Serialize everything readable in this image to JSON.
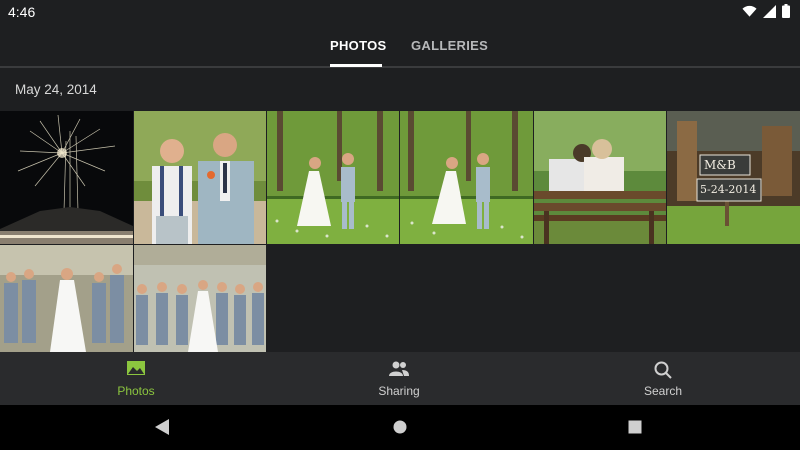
{
  "status": {
    "time": "4:46",
    "icons": [
      "wifi-icon",
      "signal-icon",
      "battery-icon"
    ]
  },
  "tabs": [
    {
      "label": "PHOTOS",
      "selected": true
    },
    {
      "label": "GALLERIES",
      "selected": false
    }
  ],
  "date_header": "May 24, 2014",
  "photos": [
    {
      "subject": "fireworks over tent at night"
    },
    {
      "subject": "two grooms standing together"
    },
    {
      "subject": "couple walking in park"
    },
    {
      "subject": "couple walking in park"
    },
    {
      "subject": "couple sitting on bench"
    },
    {
      "subject": "M&B 5-24-2014 sign",
      "sign_text_top": "M&B",
      "sign_text_bottom": "5-24-2014"
    },
    {
      "subject": "bridesmaids group"
    },
    {
      "subject": "bridal party lineup"
    }
  ],
  "bottom_nav": [
    {
      "label": "Photos",
      "icon": "photos-icon",
      "active": true
    },
    {
      "label": "Sharing",
      "icon": "sharing-icon",
      "active": false
    },
    {
      "label": "Search",
      "icon": "search-icon",
      "active": false
    }
  ],
  "system_nav": [
    "back-icon",
    "home-icon",
    "recents-icon"
  ],
  "colors": {
    "accent": "#8cc63f",
    "background": "#1e1f21",
    "nav_background": "#2a2b2d"
  }
}
